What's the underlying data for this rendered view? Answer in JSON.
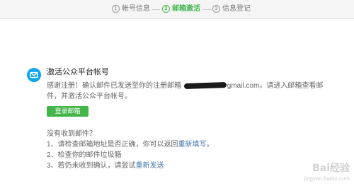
{
  "steps": [
    {
      "num": "1",
      "label": "帐号信息",
      "state": "done"
    },
    {
      "num": "2",
      "label": "邮箱激活",
      "state": "active"
    },
    {
      "num": "3",
      "label": "信息登记",
      "state": "todo"
    }
  ],
  "main": {
    "icon": "mail-icon",
    "title": "激活公众平台帐号",
    "message_prefix": "感谢注册！确认邮件已发送至你的注册邮箱",
    "email_visible": "gmail.com",
    "message_suffix": "。请进入邮箱查看邮件，并激活公众平台帐号。",
    "login_button": "登录邮箱"
  },
  "help": {
    "heading": "没有收到邮件？",
    "item1_text": "1、请检查邮箱地址是否正确，你可以返回",
    "item1_link": "重新填写",
    "item1_end": "。",
    "item2_text": "2、检查你的邮件垃圾箱",
    "item3_text": "3、若仍未收到确认，请尝试",
    "item3_link": "重新发送"
  },
  "watermark": {
    "text": "Bai经验",
    "url": "jingyan.baidu.com"
  },
  "colors": {
    "accent_green": "#44b549",
    "link_blue": "#4a79b5",
    "icon_blue": "#0ea5ef"
  }
}
